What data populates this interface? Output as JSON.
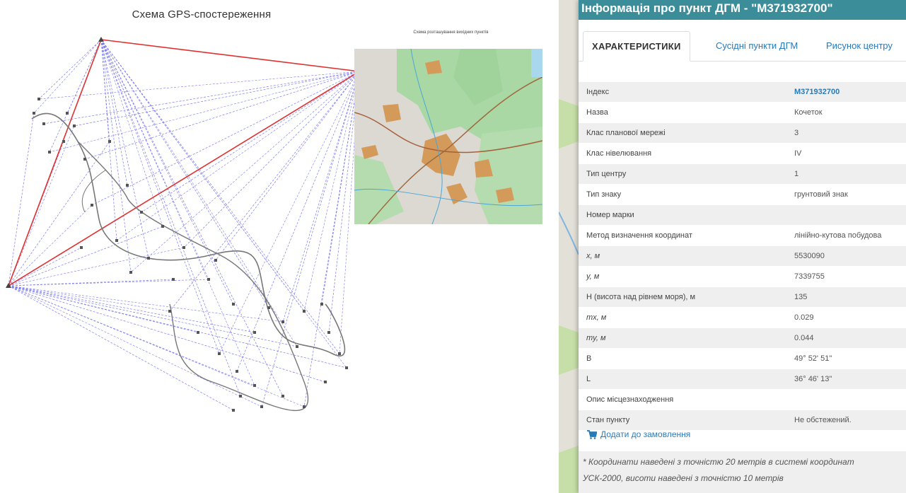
{
  "scheme": {
    "title": "Схема GPS-спостереження",
    "map_title": "Схема розташування вихідних пунктів"
  },
  "panel": {
    "header": "Інформація про пункт ДГМ - \"М371932700\"",
    "tabs": [
      "ХАРАКТЕРИСТИКИ",
      "Сусідні пункти ДГМ",
      "Рисунок центру"
    ],
    "rows": [
      {
        "key": "Індекс",
        "value": "М371932700"
      },
      {
        "key": "Назва",
        "value": "Кочеток"
      },
      {
        "key": "Клас планової мережі",
        "value": "3"
      },
      {
        "key": "Клас нівелювання",
        "value": "IV"
      },
      {
        "key": "Тип центру",
        "value": "1"
      },
      {
        "key": "Тип знаку",
        "value": "грунтовий знак"
      },
      {
        "key": "Номер марки",
        "value": ""
      },
      {
        "key": "Метод визначення координат",
        "value": "лінійно-кутова побудова"
      },
      {
        "key": "x, м",
        "value": "5530090"
      },
      {
        "key": "y, м",
        "value": "7339755"
      },
      {
        "key": "H (висота над рівнем моря), м",
        "value": "135"
      },
      {
        "key": "mx, м",
        "value": "0.029"
      },
      {
        "key": "my, м",
        "value": "0.044"
      },
      {
        "key": "B",
        "value": "49° 52' 51\""
      },
      {
        "key": "L",
        "value": "36° 46' 13\""
      },
      {
        "key": "Опис місцезнаходження",
        "value": ""
      },
      {
        "key": "Стан пункту",
        "value": "Не обстежений."
      }
    ],
    "order_link": "Додати до замовлення",
    "note_line1": "* Координати наведені з точністю 20 метрів в системі координат",
    "note_line2": "УСК-2000, висоти наведені з точністю 10 метрів"
  },
  "colors": {
    "header": "#3a8d99",
    "link": "#2a7ab8",
    "red_line": "#e03030",
    "blue_line": "#7b7bef"
  }
}
